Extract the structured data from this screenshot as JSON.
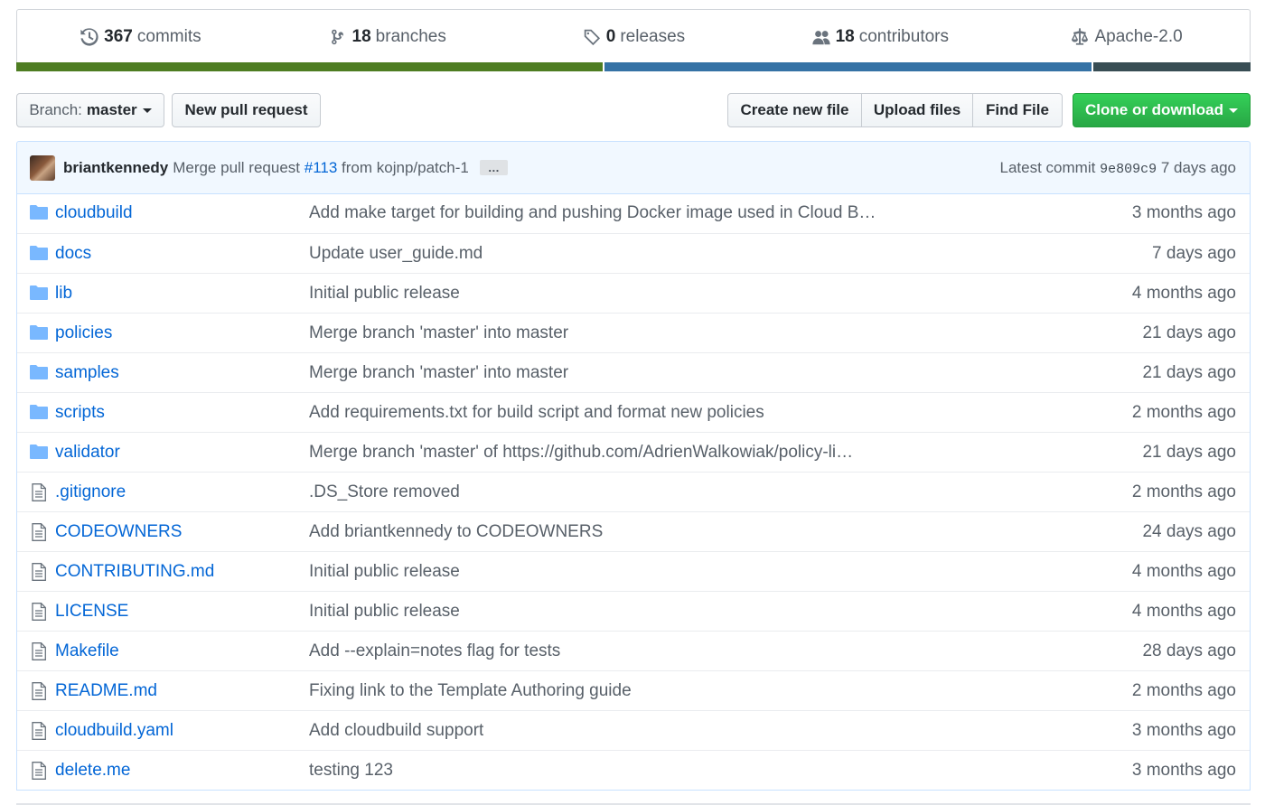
{
  "summary": {
    "commits": {
      "count": "367",
      "label": "commits",
      "icon": "history-icon"
    },
    "branches": {
      "count": "18",
      "label": "branches",
      "icon": "branch-icon"
    },
    "releases": {
      "count": "0",
      "label": "releases",
      "icon": "tag-icon"
    },
    "contributors": {
      "count": "18",
      "label": "contributors",
      "icon": "people-icon"
    },
    "license": {
      "label": "Apache-2.0",
      "icon": "law-icon"
    }
  },
  "language_bar": {
    "segments": [
      {
        "color": "#4e7d22",
        "share": 0.475
      },
      {
        "color": "#3572A5",
        "share": 0.396
      },
      {
        "color": "#384d54",
        "share": 0.129
      }
    ]
  },
  "toolbar": {
    "branch_prefix": "Branch:",
    "branch_name": "master",
    "new_pull_request": "New pull request",
    "create_new_file": "Create new file",
    "upload_files": "Upload files",
    "find_file": "Find File",
    "clone_or_download": "Clone or download"
  },
  "commit": {
    "author": "briantkennedy",
    "message_prefix": "Merge pull request",
    "pr_number": "#113",
    "message_suffix": "from kojnp/patch-1",
    "ellipsis": "…",
    "latest_label": "Latest commit",
    "sha": "9e809c9",
    "age": "7 days ago"
  },
  "files": [
    {
      "type": "dir",
      "name": "cloudbuild",
      "message": "Add make target for building and pushing Docker image used in Cloud B…",
      "age": "3 months ago"
    },
    {
      "type": "dir",
      "name": "docs",
      "message": "Update user_guide.md",
      "age": "7 days ago"
    },
    {
      "type": "dir",
      "name": "lib",
      "message": "Initial public release",
      "age": "4 months ago"
    },
    {
      "type": "dir",
      "name": "policies",
      "message": "Merge branch 'master' into master",
      "age": "21 days ago"
    },
    {
      "type": "dir",
      "name": "samples",
      "message": "Merge branch 'master' into master",
      "age": "21 days ago"
    },
    {
      "type": "dir",
      "name": "scripts",
      "message": "Add requirements.txt for build script and format new policies",
      "age": "2 months ago"
    },
    {
      "type": "dir",
      "name": "validator",
      "message_prefix": "Merge branch 'master' of ",
      "message_link": "https://github.com/AdrienWalkowiak/policy-li…",
      "age": "21 days ago"
    },
    {
      "type": "file",
      "name": ".gitignore",
      "message": ".DS_Store removed",
      "age": "2 months ago"
    },
    {
      "type": "file",
      "name": "CODEOWNERS",
      "message": "Add briantkennedy to CODEOWNERS",
      "age": "24 days ago"
    },
    {
      "type": "file",
      "name": "CONTRIBUTING.md",
      "message": "Initial public release",
      "age": "4 months ago"
    },
    {
      "type": "file",
      "name": "LICENSE",
      "message": "Initial public release",
      "age": "4 months ago"
    },
    {
      "type": "file",
      "name": "Makefile",
      "message": "Add --explain=notes flag for tests",
      "age": "28 days ago"
    },
    {
      "type": "file",
      "name": "README.md",
      "message": "Fixing link to the Template Authoring guide",
      "age": "2 months ago"
    },
    {
      "type": "file",
      "name": "cloudbuild.yaml",
      "message": "Add cloudbuild support",
      "age": "3 months ago"
    },
    {
      "type": "file",
      "name": "delete.me",
      "message": "testing 123",
      "age": "3 months ago"
    }
  ]
}
